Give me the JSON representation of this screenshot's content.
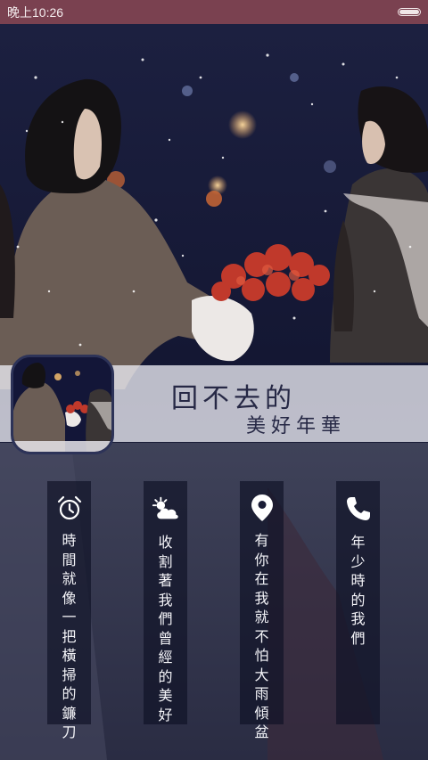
{
  "status_bar": {
    "time": "晚上10:26",
    "battery_icon": "battery-icon",
    "background_color": "#7a4150"
  },
  "banner": {
    "title_line1": "回不去的",
    "title_line2": "美好年華"
  },
  "cards": [
    {
      "icon": "alarm-clock-icon",
      "text": "時間就像一把橫掃的鐮刀"
    },
    {
      "icon": "sun-cloud-icon",
      "text": "收割著我們曾經的美好"
    },
    {
      "icon": "location-pin-icon",
      "text": "有你在我就不怕大雨傾盆"
    },
    {
      "icon": "phone-icon",
      "text": "年少時的我們"
    }
  ]
}
